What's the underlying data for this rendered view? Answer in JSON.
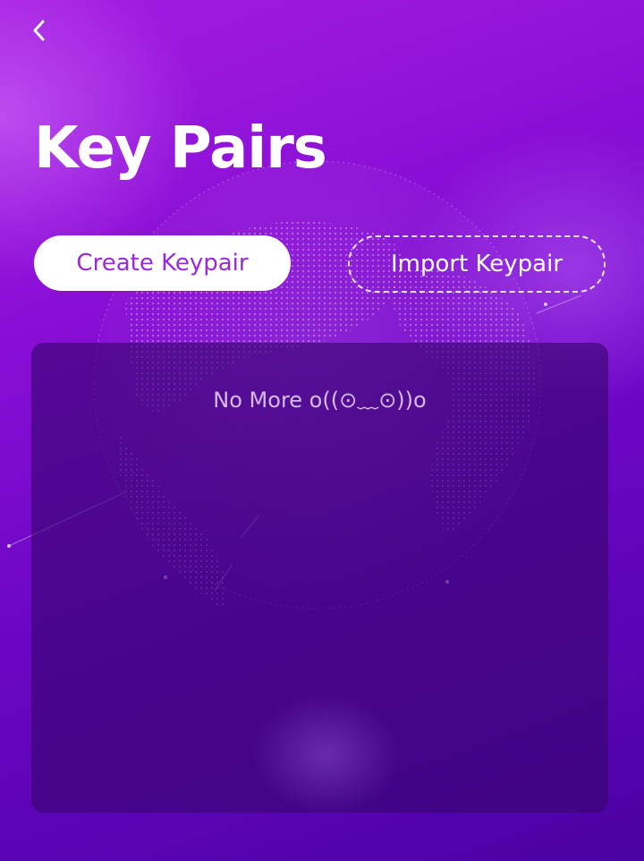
{
  "header": {
    "back_icon": "chevron-left-icon",
    "title": "Key Pairs"
  },
  "actions": {
    "create_label": "Create Keypair",
    "import_label": "Import Keypair"
  },
  "list": {
    "empty_text": "No More o((⊙﹏⊙))o"
  },
  "colors": {
    "background_top": "#a41de0",
    "background_bottom": "#4a02a2",
    "accent_text": "#9a2ad8",
    "panel": "#37056e"
  }
}
